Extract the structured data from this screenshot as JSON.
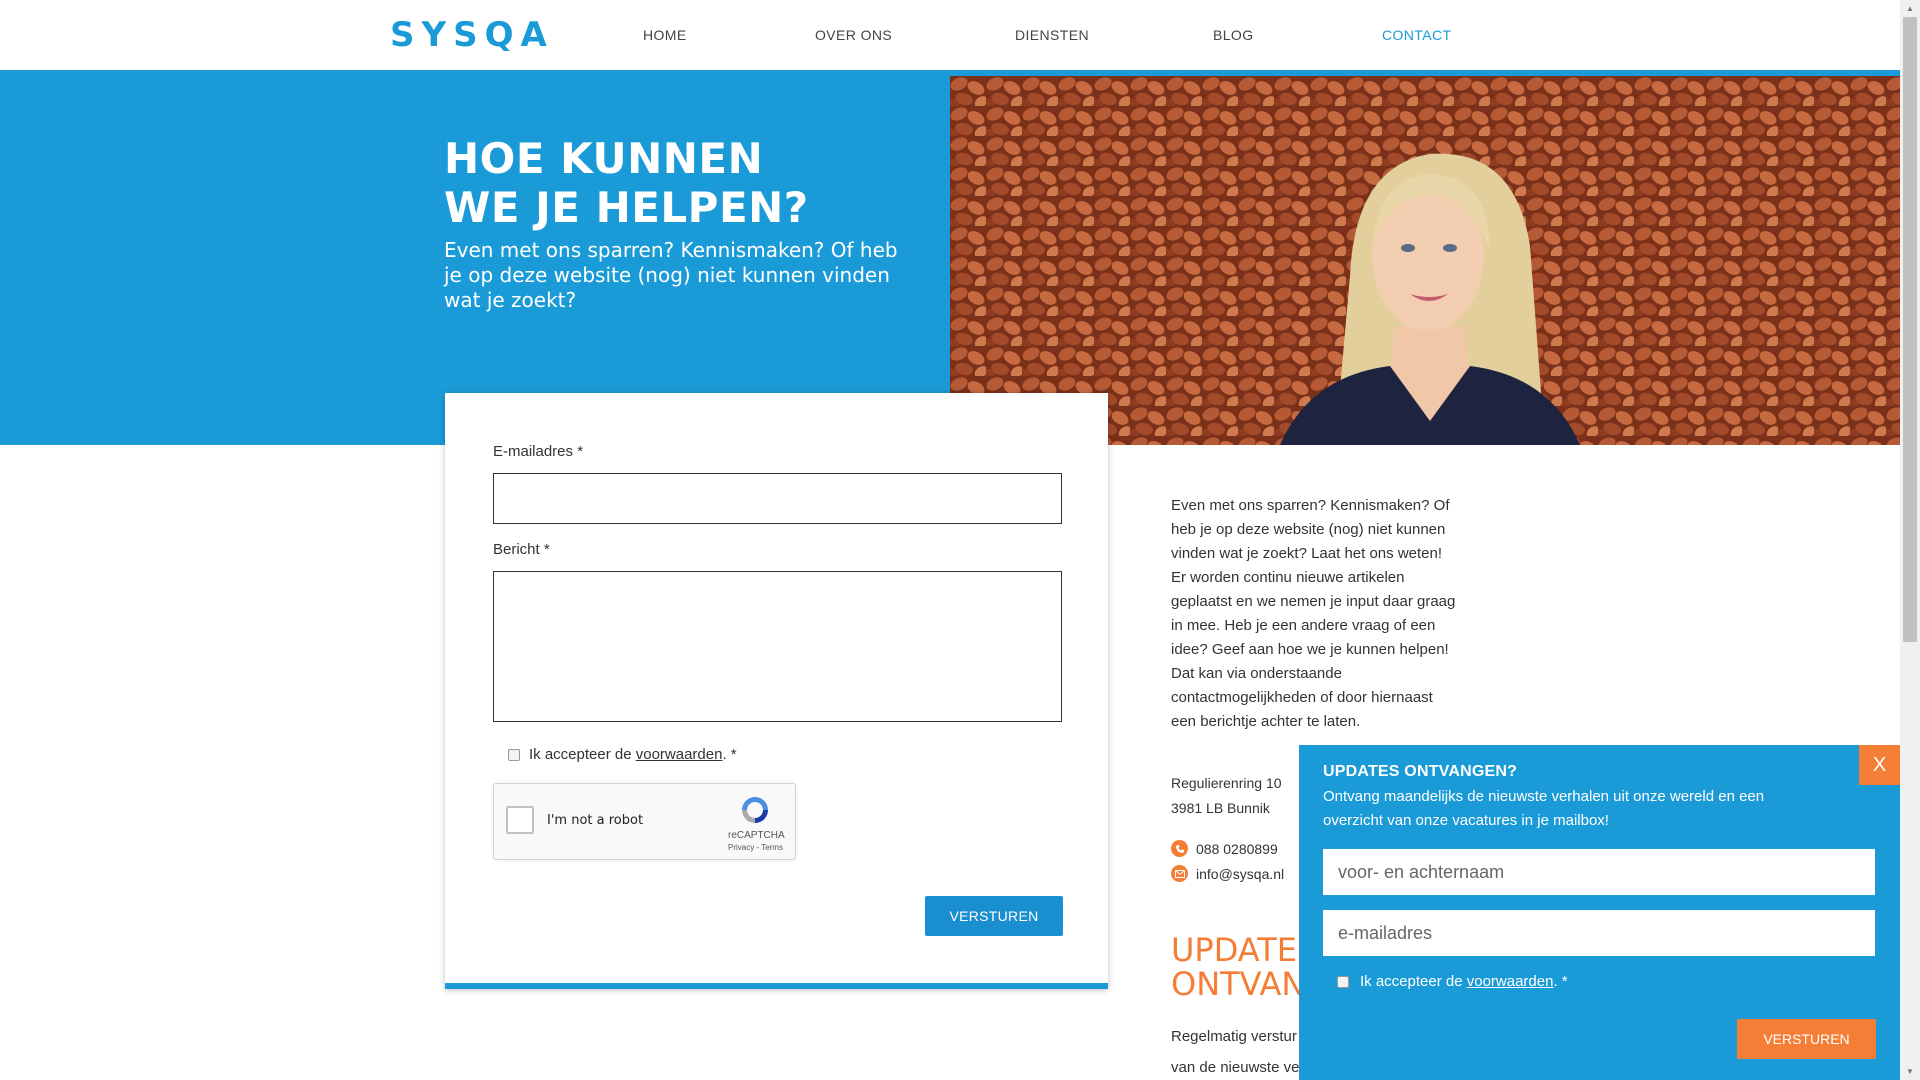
{
  "header": {
    "logo": "SYSQA",
    "nav": [
      {
        "label": "HOME"
      },
      {
        "label": "OVER ONS"
      },
      {
        "label": "DIENSTEN"
      },
      {
        "label": "BLOG"
      },
      {
        "label": "CONTACT"
      }
    ]
  },
  "hero": {
    "title_line1": "HOE KUNNEN",
    "title_line2": "WE JE HELPEN?",
    "subtitle": "Even met ons sparren? Kennismaken? Of heb je op deze website (nog) niet kunnen vinden wat je zoekt?"
  },
  "form": {
    "email_label": "E-mailadres",
    "message_label": "Bericht",
    "required_mark": "*",
    "accept_prefix": "Ik accepteer de ",
    "accept_link": "voorwaarden",
    "accept_suffix": ". *",
    "recaptcha_label": "I'm not a robot",
    "recaptcha_brand": "reCAPTCHA",
    "recaptcha_links": "Privacy - Terms",
    "submit": "VERSTUREN"
  },
  "info": {
    "intro": "Even met ons sparren? Kennismaken? Of heb je op deze website (nog) niet kunnen vinden wat je zoekt? Laat het ons weten! Er worden continu nieuwe artikelen geplaatst en we nemen je input daar graag in mee. Heb je een andere vraag of een idee? Geef aan hoe we je kunnen helpen! Dat kan via onderstaande contactmogelijkheden of door hiernaast een berichtje achter te laten.",
    "address_line1": "Regulierenring 10",
    "address_line2": "3981 LB Bunnik",
    "phone": "088 0280899",
    "email": "info@sysqa.nl",
    "updates_line1": "UPDATES",
    "updates_line2": "ONTVANG",
    "updates_text1": "Regelmatig verstur",
    "updates_text2": "van de nieuwste ve"
  },
  "popup": {
    "close": "X",
    "title": "UPDATES ONTVANGEN?",
    "text": "Ontvang maandelijks de nieuwste verhalen uit onze wereld en een overzicht van onze vacatures in je mailbox!",
    "name_placeholder": "voor- en achternaam",
    "email_placeholder": "e-mailadres",
    "accept_prefix": "Ik accepteer de ",
    "accept_link": "voorwaarden",
    "accept_suffix": ". *",
    "submit": "VERSTUREN"
  },
  "colors": {
    "brand_blue": "#1a9bd7",
    "accent_orange": "#f47e36"
  }
}
